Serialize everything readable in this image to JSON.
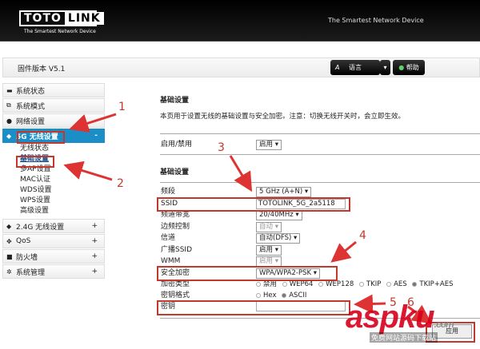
{
  "header": {
    "logo_left": "TOTO",
    "logo_right": "LINK",
    "logo_tagline": "The Smartest Network Device",
    "tagline": "The Smartest Network Device"
  },
  "toolbar": {
    "firmware": "固件版本 V5.1",
    "language": "语言",
    "help": "帮助"
  },
  "sidebar": {
    "items": [
      {
        "label": "系统状态",
        "icon": "monitor-icon"
      },
      {
        "label": "系统模式",
        "icon": "window-icon"
      },
      {
        "label": "网络设置",
        "icon": "globe-icon"
      },
      {
        "label": "5G 无线设置",
        "icon": "wifi-icon",
        "toggle": "-"
      },
      {
        "label": "2.4G 无线设置",
        "icon": "wifi-icon",
        "toggle": "+"
      },
      {
        "label": "QoS",
        "icon": "qos-icon",
        "toggle": "+"
      },
      {
        "label": "防火墙",
        "icon": "lock-icon",
        "toggle": "+"
      },
      {
        "label": "系统管理",
        "icon": "gear-icon",
        "toggle": "+"
      }
    ],
    "sub": [
      "无线状态",
      "基础设置",
      "多AP设置",
      "MAC认证",
      "WDS设置",
      "WPS设置",
      "高级设置"
    ]
  },
  "main": {
    "title": "基础设置",
    "description": "本页用于设置无线的基础设置与安全加密。注意：切换无线开关时，会立即生效。",
    "enable_label": "启用/禁用",
    "enable_value": "启用",
    "section": "基础设置",
    "rows": [
      {
        "label": "频段",
        "value": "5 GHz (A+N)"
      },
      {
        "label": "SSID",
        "value": "TOTOLINK_5G_2a5118"
      },
      {
        "label": "频道带宽",
        "value": "20/40MHz"
      },
      {
        "label": "边频控制",
        "value": "自动"
      },
      {
        "label": "信道",
        "value": "自动(DFS)"
      },
      {
        "label": "广播SSID",
        "value": "启用"
      },
      {
        "label": "WMM",
        "value": "启用"
      },
      {
        "label": "安全加密",
        "value": "WPA/WPA2-PSK"
      }
    ],
    "enc_label": "加密类型",
    "enc_options": [
      "禁用",
      "WEP64",
      "WEP128",
      "TKIP",
      "AES",
      "TKIP+AES"
    ],
    "fmt_label": "密钥格式",
    "fmt_options": [
      "Hex",
      "ASCII"
    ],
    "key_label": "密钥",
    "key_value": "",
    "apply": "应用"
  },
  "annotations": [
    "1",
    "2",
    "3",
    "4",
    "5",
    "6"
  ],
  "watermark": {
    "text": "aspku",
    "sub": "免费网站源码下载站",
    "domain": ".com"
  }
}
